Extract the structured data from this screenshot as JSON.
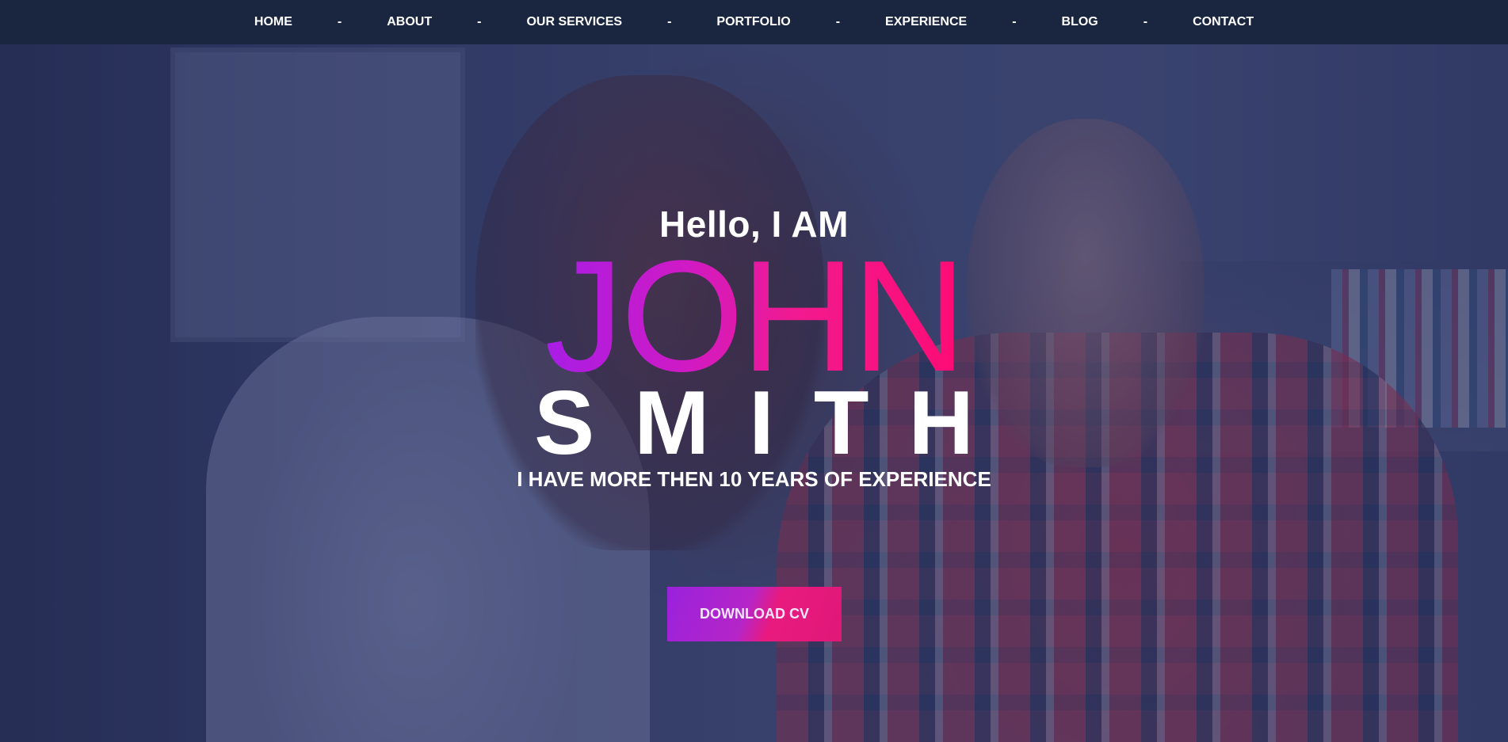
{
  "nav": {
    "items": [
      {
        "label": "HOME"
      },
      {
        "label": "ABOUT"
      },
      {
        "label": "OUR SERVICES"
      },
      {
        "label": "PORTFOLIO"
      },
      {
        "label": "EXPERIENCE"
      },
      {
        "label": "BLOG"
      },
      {
        "label": "CONTACT"
      }
    ],
    "separator": "-"
  },
  "hero": {
    "greeting": "Hello, I AM",
    "first_name": "JOHN",
    "last_name": "SMITH",
    "tagline": "I HAVE MORE THEN 10 YEARS OF EXPERIENCE",
    "cta_label": "DOWNLOAD CV"
  },
  "colors": {
    "navbar_bg": "#1a2640",
    "gradient_start": "#a41ee8",
    "gradient_end": "#ff0a72",
    "text_primary": "#ffffff"
  }
}
